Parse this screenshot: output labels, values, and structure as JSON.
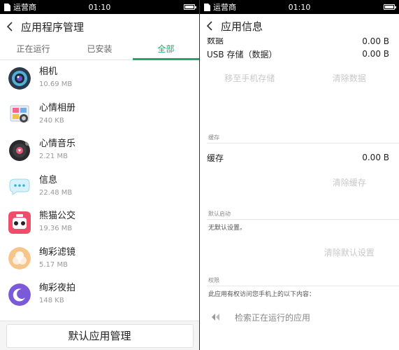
{
  "status_bar": {
    "carrier": "运营商",
    "time": "01:10"
  },
  "left": {
    "title": "应用程序管理",
    "tabs": [
      {
        "label": "正在运行",
        "active": false
      },
      {
        "label": "已安装",
        "active": false
      },
      {
        "label": "全部",
        "active": true
      }
    ],
    "apps": [
      {
        "name": "相机",
        "size": "10.69 MB",
        "icon": "camera-app-icon"
      },
      {
        "name": "心情相册",
        "size": "240 KB",
        "icon": "mood-album-app-icon"
      },
      {
        "name": "心情音乐",
        "size": "2.21 MB",
        "icon": "mood-music-app-icon"
      },
      {
        "name": "信息",
        "size": "22.48 MB",
        "icon": "messages-app-icon"
      },
      {
        "name": "熊猫公交",
        "size": "19.36 MB",
        "icon": "panda-bus-app-icon"
      },
      {
        "name": "绚彩滤镜",
        "size": "5.17 MB",
        "icon": "filter-app-icon"
      },
      {
        "name": "绚彩夜拍",
        "size": "148 KB",
        "icon": "night-shot-app-icon"
      }
    ],
    "bottom_button": "默认应用管理"
  },
  "right": {
    "title": "应用信息",
    "partial_row": {
      "label": "数据",
      "value": "0.00 B"
    },
    "usb_row": {
      "label": "USB 存储（数据）",
      "value": "0.00 B"
    },
    "btn_move": "移至手机存储",
    "btn_clear_data": "清除数据",
    "cache_section": "缓存",
    "cache_row": {
      "label": "缓存",
      "value": "0.00 B"
    },
    "btn_clear_cache": "清除缓存",
    "default_section": "默认启动",
    "default_note": "无默认设置。",
    "btn_clear_defaults": "清除默认设置",
    "perm_section": "权限",
    "perm_note": "此应用有权访问您手机上的以下内容：",
    "perm_item": "检索正在运行的应用"
  },
  "colors": {
    "accent": "#1fa86b",
    "disabled": "#c8c8c8"
  }
}
